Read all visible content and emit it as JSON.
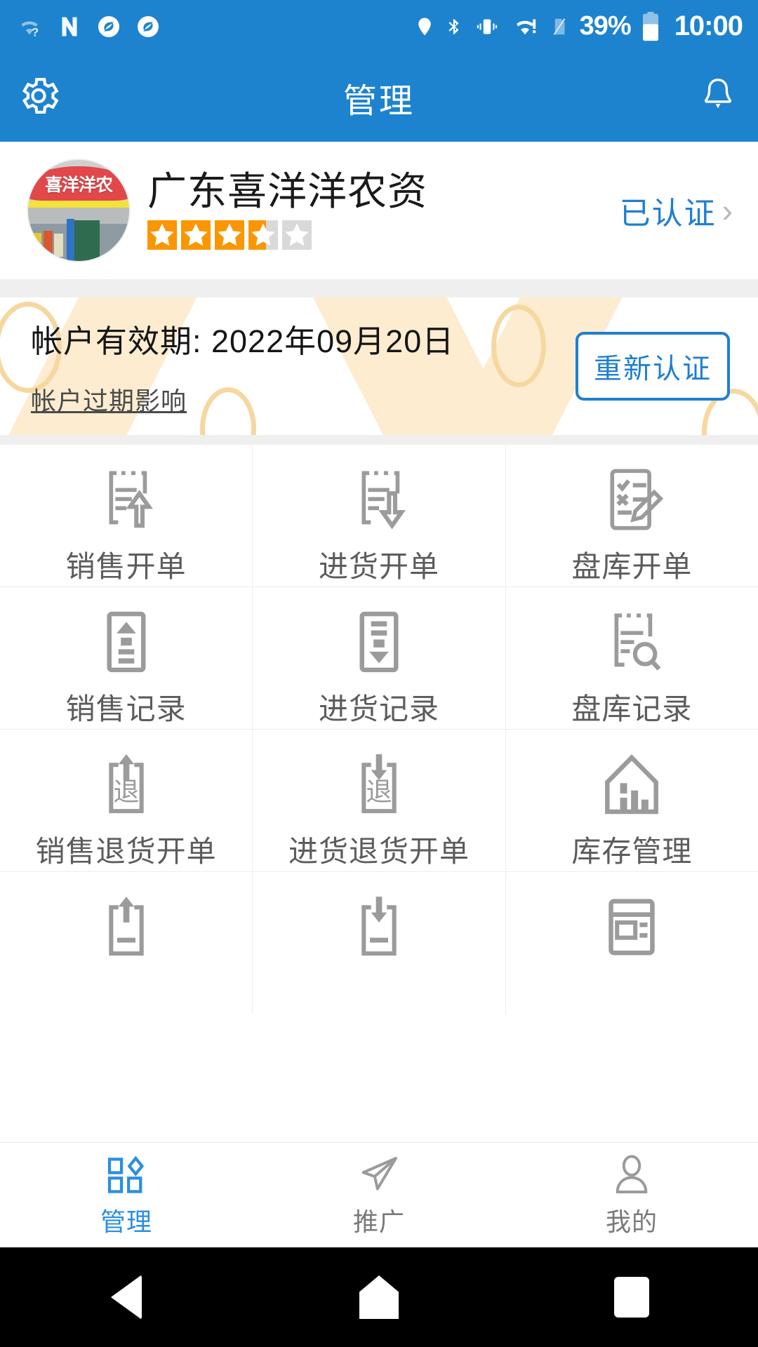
{
  "status_bar": {
    "icons_left": [
      "wifi-question-icon",
      "n-letter-icon",
      "sync-icon",
      "sync-icon-2"
    ],
    "icons_right": [
      "location-pin-icon",
      "bluetooth-icon",
      "vibrate-icon",
      "wifi-alert-icon",
      "sim-card-icon"
    ],
    "battery_percent": "39%",
    "clock": "10:00"
  },
  "appbar": {
    "title": "管理",
    "left_icon": "gear-icon",
    "right_icon": "bell-icon"
  },
  "profile": {
    "shop_name": "广东喜洋洋农资",
    "avatar_sign_text": "喜洋洋农",
    "rating": 3.6,
    "stars_total": 5,
    "verify_label": "已认证",
    "chevron": "›"
  },
  "account": {
    "validity_label": "帐户有效期: 2022年09月20日",
    "expire_link": "帐户过期影响",
    "recertify_button": "重新认证"
  },
  "grid": {
    "items": [
      {
        "label": "销售开单",
        "icon": "clipboard-up-arrow-icon"
      },
      {
        "label": "进货开单",
        "icon": "clipboard-down-arrow-icon"
      },
      {
        "label": "盘库开单",
        "icon": "checklist-pencil-icon"
      },
      {
        "label": "销售记录",
        "icon": "box-up-triangle-icon"
      },
      {
        "label": "进货记录",
        "icon": "box-down-triangle-icon"
      },
      {
        "label": "盘库记录",
        "icon": "clipboard-search-icon"
      },
      {
        "label": "销售退货开单",
        "icon": "return-up-arrow-icon",
        "glyph": "退"
      },
      {
        "label": "进货退货开单",
        "icon": "return-down-arrow-icon",
        "glyph": "退"
      },
      {
        "label": "库存管理",
        "icon": "warehouse-icon"
      },
      {
        "label": "",
        "icon": "doc-up-arrow-icon"
      },
      {
        "label": "",
        "icon": "doc-down-arrow-icon"
      },
      {
        "label": "",
        "icon": "report-table-icon"
      }
    ]
  },
  "tabbar": {
    "tabs": [
      {
        "label": "管理",
        "icon": "dashboard-icon",
        "active": true
      },
      {
        "label": "推广",
        "icon": "paper-plane-icon",
        "active": false
      },
      {
        "label": "我的",
        "icon": "person-icon",
        "active": false
      }
    ]
  },
  "android_nav": {
    "back": "back-triangle-icon",
    "home": "home-pentagon-icon",
    "recents": "recents-square-icon"
  },
  "colors": {
    "brand_blue": "#1d83ce",
    "link_blue": "#1f7fd0",
    "star_orange": "#fa9600",
    "star_gray": "#d9d9d9",
    "icon_gray": "#9b9b9b",
    "banner_accent": "#fdecd0"
  }
}
